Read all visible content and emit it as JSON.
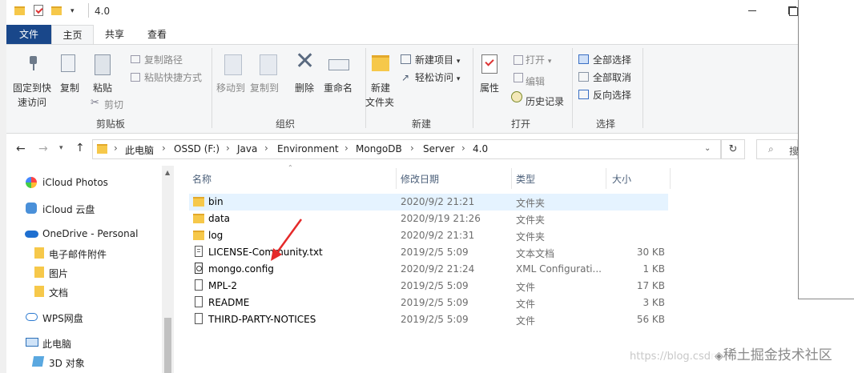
{
  "window": {
    "title": "4.0"
  },
  "tabs": [
    "文件",
    "主页",
    "共享",
    "查看"
  ],
  "ribbon": {
    "clipboard": {
      "pin_label_1": "固定到快",
      "pin_label_2": "速访问",
      "copy": "复制",
      "paste": "粘贴",
      "copy_path": "复制路径",
      "paste_shortcut": "粘贴快捷方式",
      "cut": "剪切",
      "group": "剪贴板"
    },
    "organize": {
      "move_to": "移动到",
      "copy_to": "复制到",
      "delete": "删除",
      "rename": "重命名",
      "group": "组织"
    },
    "new": {
      "new_folder_1": "新建",
      "new_folder_2": "文件夹",
      "new_item": "新建项目",
      "easy_access": "轻松访问",
      "group": "新建"
    },
    "open": {
      "properties": "属性",
      "open": "打开",
      "edit": "编辑",
      "history": "历史记录",
      "group": "打开"
    },
    "select": {
      "select_all": "全部选择",
      "select_none": "全部取消",
      "invert": "反向选择",
      "group": "选择"
    }
  },
  "breadcrumb": [
    "此电脑",
    "OSSD (F:)",
    "Java",
    "Environment",
    "MongoDB",
    "Server",
    "4.0"
  ],
  "search": {
    "placeholder": "搜"
  },
  "nav_pane": [
    "iCloud Photos",
    "iCloud 云盘",
    "OneDrive - Personal",
    "电子邮件附件",
    "图片",
    "文档",
    "WPS网盘",
    "此电脑",
    "3D 对象"
  ],
  "columns": {
    "name": "名称",
    "date": "修改日期",
    "type": "类型",
    "size": "大小"
  },
  "files": [
    {
      "name": "bin",
      "date": "2020/9/2 21:21",
      "type": "文件夹",
      "size": "",
      "icon": "folder"
    },
    {
      "name": "data",
      "date": "2020/9/19 21:26",
      "type": "文件夹",
      "size": "",
      "icon": "folder"
    },
    {
      "name": "log",
      "date": "2020/9/2 21:31",
      "type": "文件夹",
      "size": "",
      "icon": "folder"
    },
    {
      "name": "LICENSE-Community.txt",
      "date": "2019/2/5 5:09",
      "type": "文本文档",
      "size": "30 KB",
      "icon": "text-file"
    },
    {
      "name": "mongo.config",
      "date": "2020/9/2 21:24",
      "type": "XML Configurati...",
      "size": "1 KB",
      "icon": "config-file"
    },
    {
      "name": "MPL-2",
      "date": "2019/2/5 5:09",
      "type": "文件",
      "size": "17 KB",
      "icon": "file"
    },
    {
      "name": "README",
      "date": "2019/2/5 5:09",
      "type": "文件",
      "size": "3 KB",
      "icon": "file"
    },
    {
      "name": "THIRD-PARTY-NOTICES",
      "date": "2019/2/5 5:09",
      "type": "文件",
      "size": "56 KB",
      "icon": "file"
    }
  ],
  "watermark": {
    "text": "稀土掘金技术社区",
    "faint": "https://blog.csdn.net/..."
  },
  "colors": {
    "file_tab": "#19478a",
    "selected_row": "#e5f3ff",
    "folder": "#f6c84a",
    "arrow": "#e52a2a"
  }
}
